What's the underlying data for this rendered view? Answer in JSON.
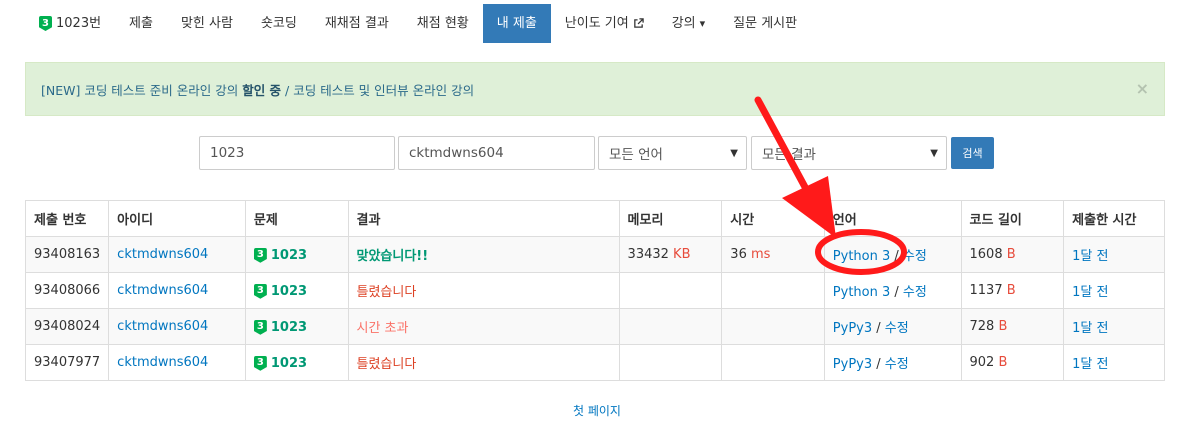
{
  "nav": {
    "items": [
      {
        "label": "1023번",
        "tier": "3"
      },
      {
        "label": "제출"
      },
      {
        "label": "맞힌 사람"
      },
      {
        "label": "숏코딩"
      },
      {
        "label": "재채점 결과"
      },
      {
        "label": "채점 현황"
      },
      {
        "label": "내 제출"
      },
      {
        "label": "난이도 기여"
      },
      {
        "label": "강의"
      },
      {
        "label": "질문 게시판"
      }
    ]
  },
  "alert": {
    "part1": "[NEW] 코딩 테스트 준비 온라인 강의 ",
    "bold": "할인 중",
    "part2": " / 코딩 테스트 및 인터뷰 온라인 강의",
    "close": "×"
  },
  "filters": {
    "problem": "1023",
    "user": "cktmdwns604",
    "language": "모든 언어",
    "result": "모든 결과",
    "search_label": "검색"
  },
  "table": {
    "headers": [
      "제출 번호",
      "아이디",
      "문제",
      "결과",
      "메모리",
      "시간",
      "언어",
      "코드 길이",
      "제출한 시간"
    ],
    "rows": [
      {
        "id": "93408163",
        "user": "cktmdwns604",
        "tier": "3",
        "problem": "1023",
        "result": "맞았습니다!!",
        "memory": "33432",
        "memory_unit": "KB",
        "time": "36",
        "time_unit": "ms",
        "lang": "Python 3",
        "edit": "수정",
        "length": "1608",
        "length_unit": "B",
        "when": "1달 전"
      },
      {
        "id": "93408066",
        "user": "cktmdwns604",
        "tier": "3",
        "problem": "1023",
        "result": "틀렸습니다",
        "memory": "",
        "memory_unit": "",
        "time": "",
        "time_unit": "",
        "lang": "Python 3",
        "edit": "수정",
        "length": "1137",
        "length_unit": "B",
        "when": "1달 전"
      },
      {
        "id": "93408024",
        "user": "cktmdwns604",
        "tier": "3",
        "problem": "1023",
        "result": "시간 초과",
        "memory": "",
        "memory_unit": "",
        "time": "",
        "time_unit": "",
        "lang": "PyPy3",
        "edit": "수정",
        "length": "728",
        "length_unit": "B",
        "when": "1달 전"
      },
      {
        "id": "93407977",
        "user": "cktmdwns604",
        "tier": "3",
        "problem": "1023",
        "result": "틀렸습니다",
        "memory": "",
        "memory_unit": "",
        "time": "",
        "time_unit": "",
        "lang": "PyPy3",
        "edit": "수정",
        "length": "902",
        "length_unit": "B",
        "when": "1달 전"
      }
    ]
  },
  "pager": {
    "label": "첫 페이지"
  },
  "colors": {
    "accent": "#337ab7",
    "annotation": "#ff1a1a",
    "tier": "#00b050"
  }
}
